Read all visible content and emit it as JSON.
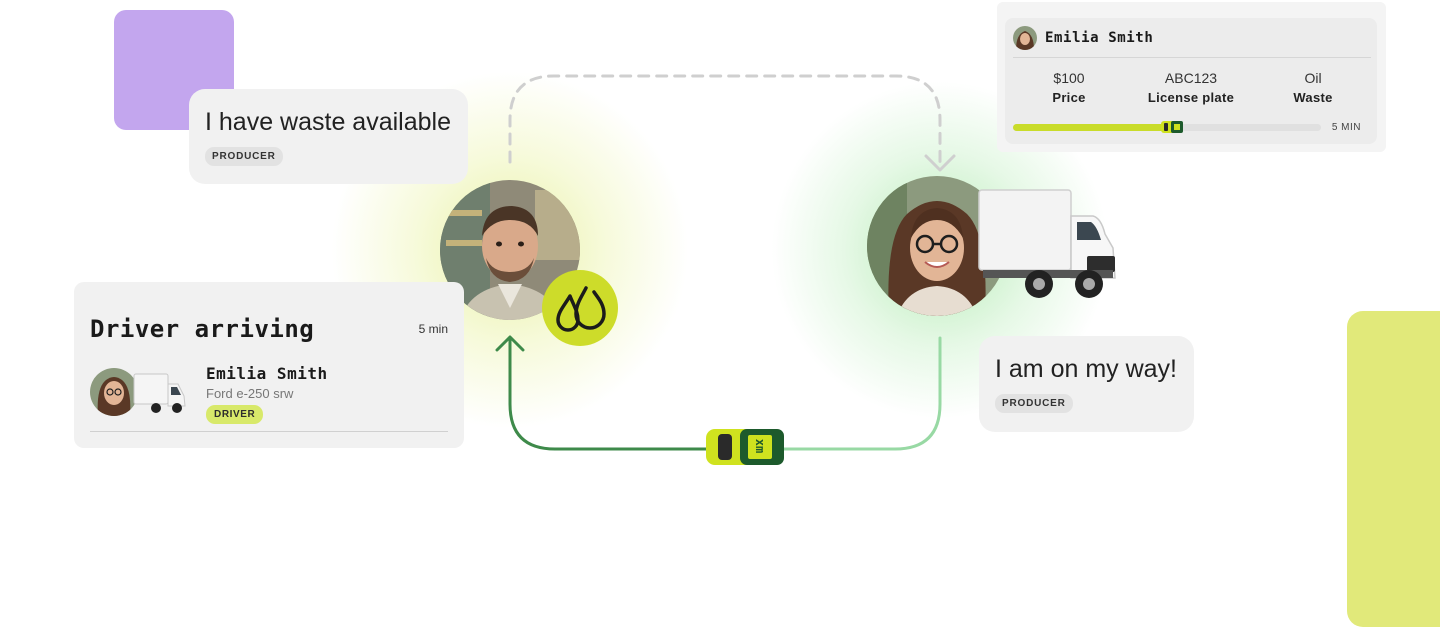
{
  "producer_bubble": {
    "text": "I have waste available",
    "tag": "PRODUCER"
  },
  "driver_bubble": {
    "text": "I am on my way!",
    "tag": "PRODUCER"
  },
  "arrival_card": {
    "title": "Driver arriving",
    "eta": "5 min",
    "driver_name": "Emilia Smith",
    "vehicle": "Ford e-250 srw",
    "role_tag": "DRIVER"
  },
  "trip_card": {
    "driver_name": "Emilia Smith",
    "stats": [
      {
        "value": "$100",
        "label": "Price"
      },
      {
        "value": "ABC123",
        "label": "License plate"
      },
      {
        "value": "Oil",
        "label": "Waste"
      }
    ],
    "progress": 0.55,
    "eta": "5 MIN"
  },
  "car_logo": "xm",
  "icons": {
    "oil_badge": "oil-drops-icon",
    "car": "taxi-car-icon",
    "truck": "box-truck-icon"
  },
  "colors": {
    "lime": "#cddc2a",
    "lime_block": "#e1e97a",
    "purple_block": "#c3a6ee",
    "route_dark_green": "#3e8a4a",
    "route_light_green": "#98d9a4",
    "dashed_route": "#cfcfcf",
    "card_bg": "#f1f1f1"
  }
}
